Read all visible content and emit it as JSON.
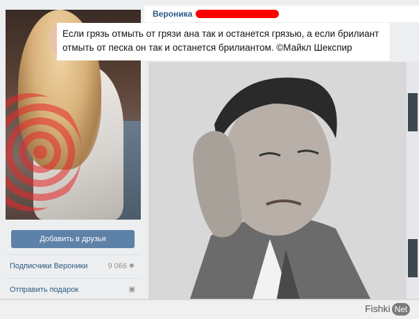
{
  "profile": {
    "name": "Вероника",
    "add_friend_label": "Добавить в друзья",
    "links": [
      {
        "label": "Подписчики Вероники",
        "count": "9 066",
        "icon": "followers-icon"
      },
      {
        "label": "Отправить подарок",
        "count": "",
        "icon": "gift-icon"
      }
    ]
  },
  "post": {
    "quote": "Если грязь отмыть от грязи ана так и останется грязью, а если брилиант отмыть от песка он так и останется брилиантом. ©Майкл Шекспир"
  },
  "watermark": {
    "brand": "Fishki",
    "brand_suffix": "Net"
  },
  "colors": {
    "link": "#2a5885",
    "button": "#5e81a8",
    "redaction": "#ff0000"
  }
}
